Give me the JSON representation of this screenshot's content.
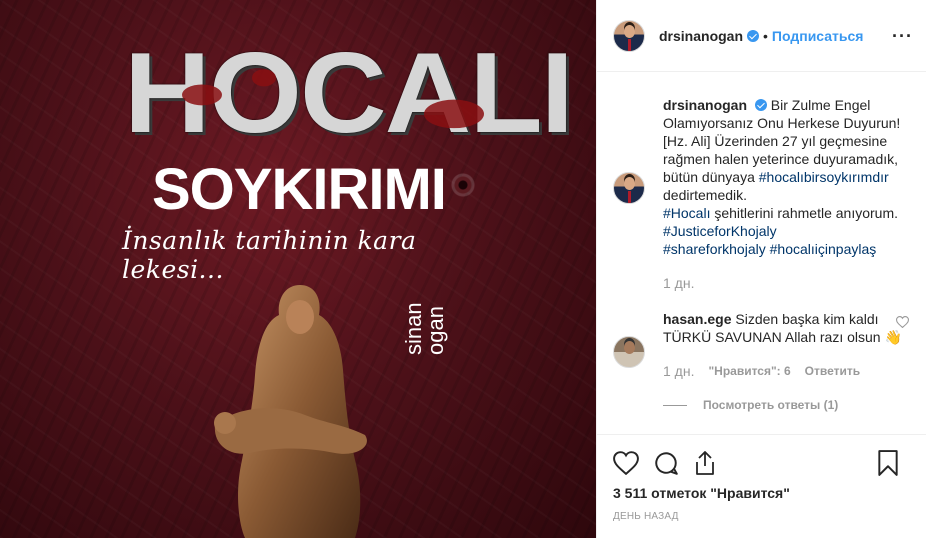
{
  "poster": {
    "title": "HOCALI",
    "subtitle": "SOYKIRIMI",
    "tagline": "İnsanlık tarihinin kara lekesi...",
    "signature_line1": "sinan",
    "signature_line2": "ogan"
  },
  "header": {
    "username": "drsinanogan",
    "dot": "•",
    "follow_label": "Подписаться",
    "more_label": "···"
  },
  "caption": {
    "username": "drsinanogan",
    "text_1": "Bir Zulme Engel Olamıyorsanız Onu Herkese Duyurun! [Hz. Ali] Üzerinden 27 yıl geçmesine rağmen halen yeterince duyuramadık, bütün dünyaya ",
    "hashtag_1": "#hocalıbirsoykırımdır",
    "text_2": " dedirtemedik.",
    "hashtag_2": "#Hocalı",
    "text_3": " şehitlerini rahmetle anıyorum.",
    "hashtag_3": "#JusticeforKhojaly",
    "hashtag_4": "#shareforkhojaly",
    "hashtag_5": "#hocalıiçinpaylaş",
    "time": "1 дн."
  },
  "comment": {
    "username": "hasan.ege",
    "text": "Sizden başka kim kaldı TÜRKÜ SAVUNAN Allah razı olsun 👋",
    "time": "1 дн.",
    "likes_label": "\"Нравится\": 6",
    "reply_label": "Ответить",
    "view_replies_label": "Посмотреть ответы (1)"
  },
  "actions": {
    "likes_label": "3 511 отметок \"Нравится\"",
    "post_time": "ДЕНЬ НАЗАД"
  },
  "colors": {
    "link_blue": "#3897f0",
    "hashtag": "#003569",
    "muted": "#999999",
    "poster_red": "#5a1119"
  },
  "icons": [
    "heart-icon",
    "comment-icon",
    "share-icon",
    "bookmark-icon",
    "verified-badge-icon",
    "more-icon"
  ]
}
